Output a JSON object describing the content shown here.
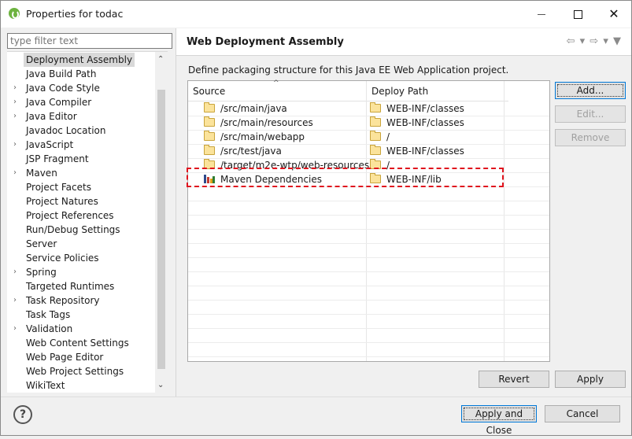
{
  "window": {
    "title": "Properties for todac",
    "minimize_icon": "minimize-icon",
    "maximize_icon": "maximize-icon",
    "close_glyph": "✕"
  },
  "filter": {
    "placeholder": "type filter text",
    "value": ""
  },
  "nav": {
    "items": [
      {
        "label": "Deployment Assembly",
        "expandable": false,
        "selected": true
      },
      {
        "label": "Java Build Path",
        "expandable": false
      },
      {
        "label": "Java Code Style",
        "expandable": true
      },
      {
        "label": "Java Compiler",
        "expandable": true
      },
      {
        "label": "Java Editor",
        "expandable": true
      },
      {
        "label": "Javadoc Location",
        "expandable": false
      },
      {
        "label": "JavaScript",
        "expandable": true
      },
      {
        "label": "JSP Fragment",
        "expandable": false
      },
      {
        "label": "Maven",
        "expandable": true
      },
      {
        "label": "Project Facets",
        "expandable": false
      },
      {
        "label": "Project Natures",
        "expandable": false
      },
      {
        "label": "Project References",
        "expandable": false
      },
      {
        "label": "Run/Debug Settings",
        "expandable": false
      },
      {
        "label": "Server",
        "expandable": false
      },
      {
        "label": "Service Policies",
        "expandable": false
      },
      {
        "label": "Spring",
        "expandable": true
      },
      {
        "label": "Targeted Runtimes",
        "expandable": false
      },
      {
        "label": "Task Repository",
        "expandable": true
      },
      {
        "label": "Task Tags",
        "expandable": false
      },
      {
        "label": "Validation",
        "expandable": true
      },
      {
        "label": "Web Content Settings",
        "expandable": false
      },
      {
        "label": "Web Page Editor",
        "expandable": false
      },
      {
        "label": "Web Project Settings",
        "expandable": false
      },
      {
        "label": "WikiText",
        "expandable": false
      }
    ],
    "arrow_glyph": "›",
    "scroll_up_glyph": "⌃",
    "scroll_down_glyph": "⌄"
  },
  "page": {
    "title": "Web Deployment Assembly",
    "nav_glyphs": "⇦ ▾ ⇨ ▾ ▼",
    "description": "Define packaging structure for this Java EE Web Application project."
  },
  "table": {
    "headers": {
      "source": "Source",
      "deploy": "Deploy Path"
    },
    "sort_glyph": "^",
    "rows": [
      {
        "source": "/src/main/java",
        "deploy": "WEB-INF/classes",
        "icon": "folder-icon"
      },
      {
        "source": "/src/main/resources",
        "deploy": "WEB-INF/classes",
        "icon": "folder-icon"
      },
      {
        "source": "/src/main/webapp",
        "deploy": "/",
        "icon": "folder-icon"
      },
      {
        "source": "/src/test/java",
        "deploy": "WEB-INF/classes",
        "icon": "folder-icon"
      },
      {
        "source": "/target/m2e-wtp/web-resources",
        "deploy": "/",
        "icon": "folder-icon"
      },
      {
        "source": "Maven Dependencies",
        "deploy": "WEB-INF/lib",
        "icon": "library-icon",
        "highlighted": true
      }
    ]
  },
  "buttons": {
    "add": "Add...",
    "edit": "Edit...",
    "remove": "Remove",
    "revert": "Revert",
    "apply": "Apply",
    "apply_close": "Apply and Close",
    "cancel": "Cancel",
    "help": "?"
  },
  "colors": {
    "highlight_border": "#e0141e",
    "selection_bg": "#d9d9d9",
    "default_button_border": "#0078d7"
  }
}
